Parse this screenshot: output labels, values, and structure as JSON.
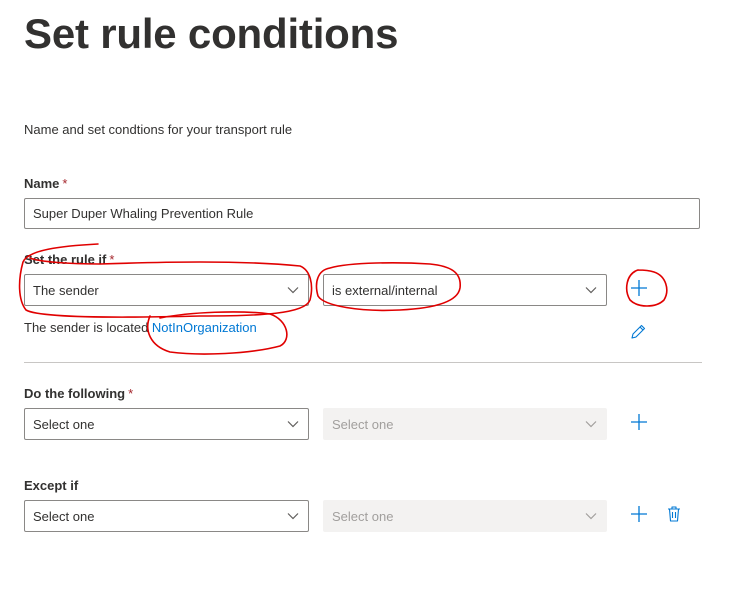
{
  "page": {
    "title": "Set rule conditions",
    "description": "Name and set condtions for your transport rule"
  },
  "name_field": {
    "label": "Name",
    "required_mark": "*",
    "value": "Super Duper Whaling Prevention Rule"
  },
  "rule_if": {
    "label": "Set the rule if",
    "required_mark": "*",
    "condition": {
      "value": "The sender"
    },
    "predicate": {
      "value": "is external/internal"
    },
    "sentence_prefix": "The sender is located",
    "sentence_link": "NotInOrganization"
  },
  "do_following": {
    "label": "Do the following",
    "required_mark": "*",
    "action": {
      "value": "Select one"
    },
    "action_detail": {
      "value": "Select one"
    }
  },
  "except_if": {
    "label": "Except if",
    "condition": {
      "value": "Select one"
    },
    "condition_detail": {
      "value": "Select one"
    }
  },
  "icons": {
    "add": "plus-icon",
    "edit": "pencil-icon",
    "delete": "trash-icon",
    "dropdown": "chevron-down-icon"
  },
  "colors": {
    "accent": "#0078d4",
    "required": "#a4262c",
    "annotation": "#e00000"
  }
}
